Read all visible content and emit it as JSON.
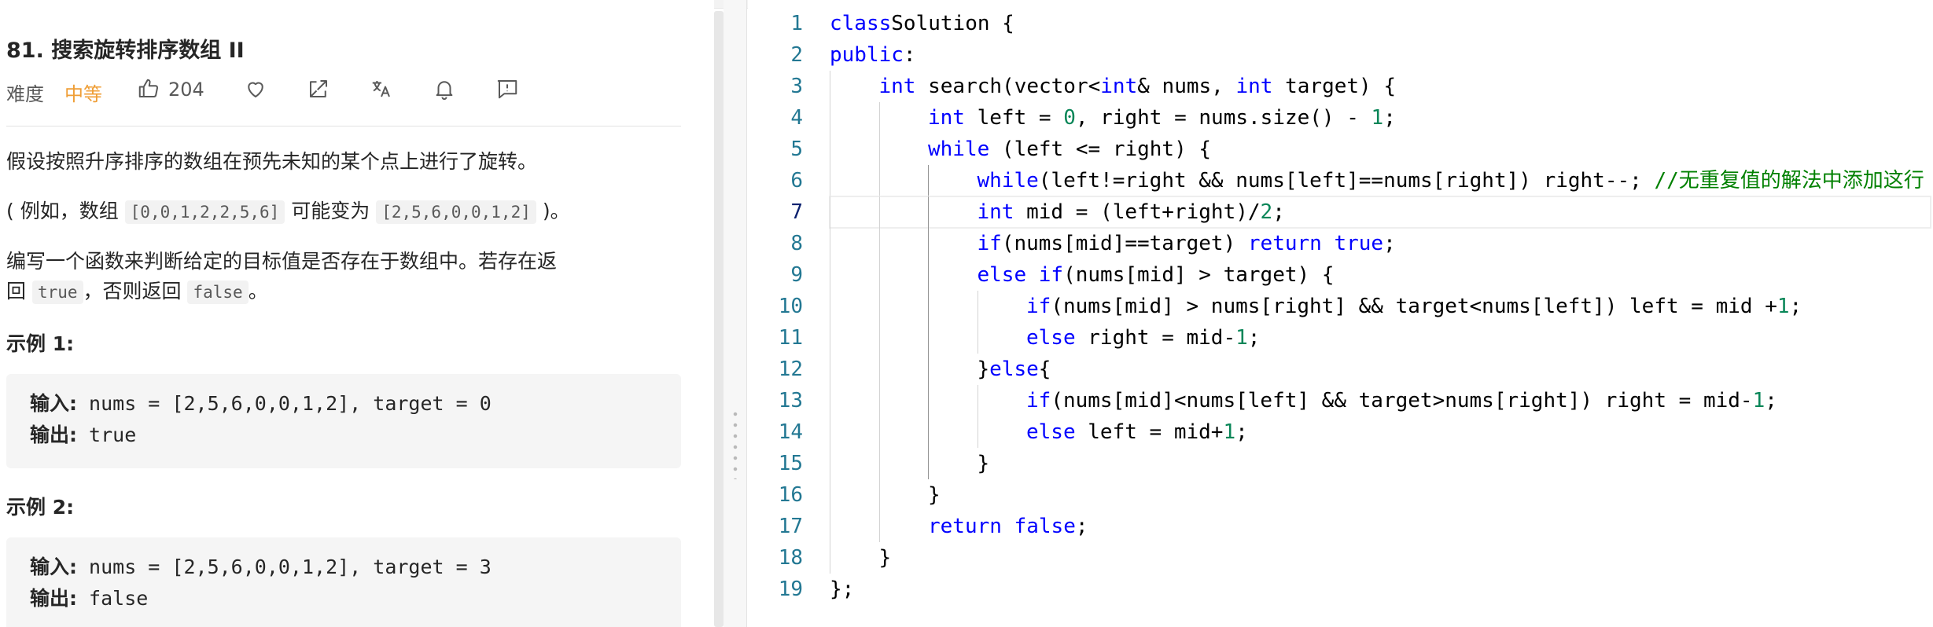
{
  "problem": {
    "title": "81. 搜索旋转排序数组 II",
    "difficulty_label": "难度",
    "difficulty": "中等",
    "likes": "204",
    "icons": [
      "thumbs-up-icon",
      "heart-icon",
      "share-icon",
      "translate-icon",
      "bell-icon",
      "feedback-icon"
    ],
    "desc1": "假设按照升序排序的数组在预先未知的某个点上进行了旋转。",
    "desc2_pre": "( 例如，数组 ",
    "desc2_code1": "[0,0,1,2,2,5,6]",
    "desc2_mid": " 可能变为 ",
    "desc2_code2": "[2,5,6,0,0,1,2]",
    "desc2_post": " )。",
    "desc3_line1": "编写一个函数来判断给定的目标值是否存在于数组中。若存在返",
    "desc3_pre": "回 ",
    "desc3_code1": "true",
    "desc3_mid": "，否则返回 ",
    "desc3_code2": "false",
    "desc3_post": "。",
    "examples": [
      {
        "title": "示例 1:",
        "input_label": "输入:",
        "input": " nums = [2,5,6,0,0,1,2], target = 0",
        "output_label": "输出:",
        "output": " true"
      },
      {
        "title": "示例 2:",
        "input_label": "输入:",
        "input": " nums = [2,5,6,0,0,1,2], target = 3",
        "output_label": "输出:",
        "output": " false"
      }
    ]
  },
  "editor": {
    "current_line": 7,
    "line_numbers": [
      "1",
      "2",
      "3",
      "4",
      "5",
      "6",
      "7",
      "8",
      "9",
      "10",
      "11",
      "12",
      "13",
      "14",
      "15",
      "16",
      "17",
      "18",
      "19"
    ],
    "lines": [
      {
        "indent": 0,
        "tokens": [
          [
            "kw",
            "class"
          ],
          [
            "",
            "Solution {"
          ]
        ]
      },
      {
        "indent": 0,
        "tokens": [
          [
            "kw",
            "public"
          ],
          [
            "",
            ":"
          ]
        ]
      },
      {
        "indent": 1,
        "tokens": [
          [
            "kw",
            "int"
          ],
          [
            "",
            " search(vector<"
          ],
          [
            "kw",
            "int"
          ],
          [
            "",
            "& nums, "
          ],
          [
            "kw",
            "int"
          ],
          [
            "",
            " target) {"
          ]
        ]
      },
      {
        "indent": 2,
        "tokens": [
          [
            "kw",
            "int"
          ],
          [
            "",
            " left = "
          ],
          [
            "num",
            "0"
          ],
          [
            "",
            ", right = nums.size() - "
          ],
          [
            "num",
            "1"
          ],
          [
            "",
            ";"
          ]
        ]
      },
      {
        "indent": 2,
        "tokens": [
          [
            "kw",
            "while"
          ],
          [
            "",
            " (left <= right) {"
          ]
        ]
      },
      {
        "indent": 3,
        "tokens": [
          [
            "kw",
            "while"
          ],
          [
            "",
            "(left!=right && nums[left]==nums[right]) right--; "
          ],
          [
            "cm",
            "//无重复值的解法中添加这行"
          ]
        ]
      },
      {
        "indent": 3,
        "tokens": [
          [
            "kw",
            "int"
          ],
          [
            "",
            " mid = (left+right)/"
          ],
          [
            "num",
            "2"
          ],
          [
            "",
            ";"
          ]
        ]
      },
      {
        "indent": 3,
        "tokens": [
          [
            "kw",
            "if"
          ],
          [
            "",
            "(nums[mid]==target) "
          ],
          [
            "kw",
            "return"
          ],
          [
            "",
            " "
          ],
          [
            "kw",
            "true"
          ],
          [
            "",
            ";"
          ]
        ]
      },
      {
        "indent": 3,
        "tokens": [
          [
            "kw",
            "else"
          ],
          [
            "",
            " "
          ],
          [
            "kw",
            "if"
          ],
          [
            "",
            "(nums[mid] > target) {"
          ]
        ]
      },
      {
        "indent": 4,
        "tokens": [
          [
            "kw",
            "if"
          ],
          [
            "",
            "(nums[mid] > nums[right] && target<nums[left]) left = mid +"
          ],
          [
            "num",
            "1"
          ],
          [
            "",
            ";"
          ]
        ]
      },
      {
        "indent": 4,
        "tokens": [
          [
            "kw",
            "else"
          ],
          [
            "",
            " right = mid-"
          ],
          [
            "num",
            "1"
          ],
          [
            "",
            ";"
          ]
        ]
      },
      {
        "indent": 3,
        "tokens": [
          [
            "",
            "}"
          ],
          [
            "kw",
            "else"
          ],
          [
            "",
            "{"
          ]
        ]
      },
      {
        "indent": 4,
        "tokens": [
          [
            "kw",
            "if"
          ],
          [
            "",
            "(nums[mid]<nums[left] && target>nums[right]) right = mid-"
          ],
          [
            "num",
            "1"
          ],
          [
            "",
            ";"
          ]
        ]
      },
      {
        "indent": 4,
        "tokens": [
          [
            "kw",
            "else"
          ],
          [
            "",
            " left = mid+"
          ],
          [
            "num",
            "1"
          ],
          [
            "",
            ";"
          ]
        ]
      },
      {
        "indent": 3,
        "tokens": [
          [
            "",
            "}"
          ]
        ]
      },
      {
        "indent": 2,
        "tokens": [
          [
            "",
            "}"
          ]
        ]
      },
      {
        "indent": 2,
        "tokens": [
          [
            "kw",
            "return"
          ],
          [
            "",
            " "
          ],
          [
            "kw",
            "false"
          ],
          [
            "",
            ";"
          ]
        ]
      },
      {
        "indent": 1,
        "tokens": [
          [
            "",
            "}"
          ]
        ]
      },
      {
        "indent": 0,
        "tokens": [
          [
            "",
            "};"
          ]
        ]
      }
    ]
  }
}
